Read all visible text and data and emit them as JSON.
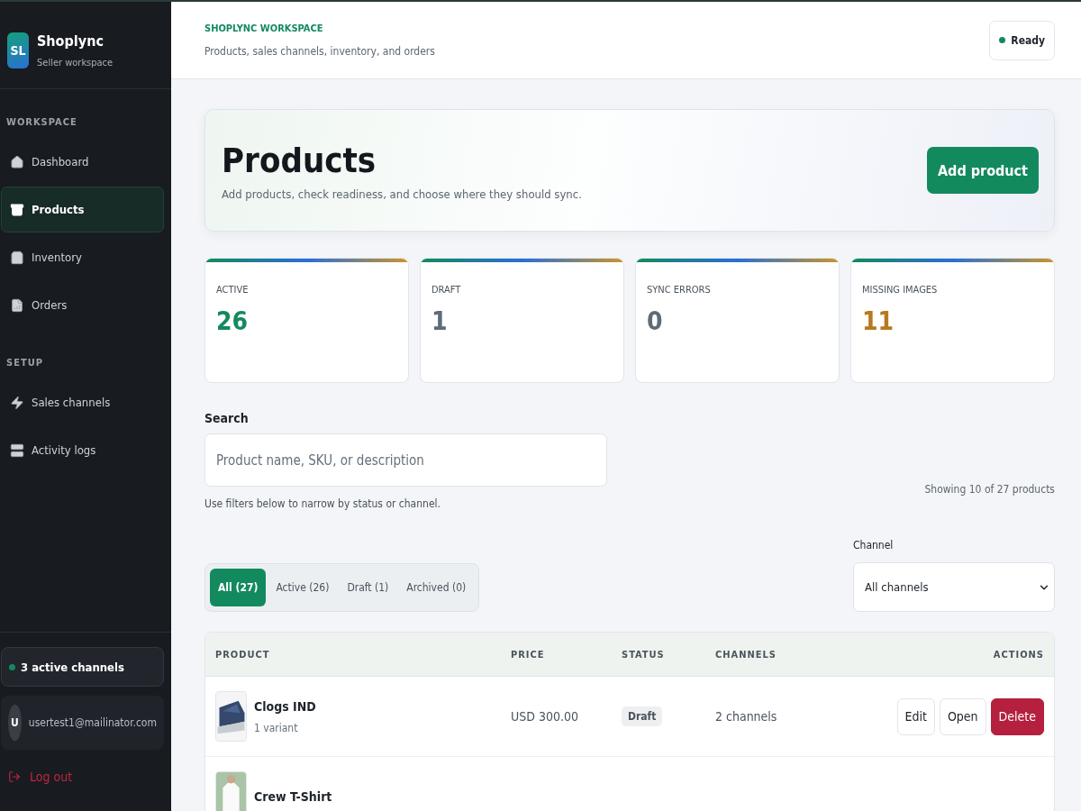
{
  "brand": {
    "initials": "SL",
    "name": "Shoplync",
    "subtitle": "Seller workspace"
  },
  "sidebar": {
    "sections": [
      {
        "heading": "WORKSPACE",
        "items": [
          {
            "label": "Dashboard",
            "selected": false
          },
          {
            "label": "Products",
            "selected": true
          },
          {
            "label": "Inventory",
            "selected": false
          },
          {
            "label": "Orders",
            "selected": false
          }
        ]
      },
      {
        "heading": "SETUP",
        "items": [
          {
            "label": "Sales channels",
            "selected": false
          },
          {
            "label": "Activity logs",
            "selected": false
          }
        ]
      }
    ],
    "channels_status": "3 active channels",
    "user": {
      "avatar": "U",
      "email": "usertest1@mailinator.com"
    },
    "logout": "Log out"
  },
  "header": {
    "eyebrow": "SHOPLYNC WORKSPACE",
    "subtitle": "Products, sales channels, inventory, and orders",
    "status": "Ready"
  },
  "hero": {
    "title": "Products",
    "description": "Add products, check readiness, and choose where they should sync.",
    "button": "Add product"
  },
  "stats": [
    {
      "label": "ACTIVE",
      "value": "26",
      "color": "#138a5e"
    },
    {
      "label": "DRAFT",
      "value": "1",
      "color": "#5f6b78"
    },
    {
      "label": "SYNC ERRORS",
      "value": "0",
      "color": "#5f6b78"
    },
    {
      "label": "MISSING IMAGES",
      "value": "11",
      "color": "#b7791f"
    }
  ],
  "search": {
    "label": "Search",
    "placeholder": "Product name, SKU, or description",
    "hint": "Use filters below to narrow by status or channel.",
    "count": "Showing 10 of 27 products"
  },
  "filters": {
    "tabs": [
      {
        "label": "All (27)",
        "selected": true
      },
      {
        "label": "Active (26)",
        "selected": false
      },
      {
        "label": "Draft (1)",
        "selected": false
      },
      {
        "label": "Archived (0)",
        "selected": false
      }
    ],
    "channel_label": "Channel",
    "channel_value": "All channels"
  },
  "table": {
    "columns": [
      "PRODUCT",
      "PRICE",
      "STATUS",
      "CHANNELS",
      "ACTIONS"
    ],
    "rows": [
      {
        "name": "Clogs IND",
        "variants": "1 variant",
        "price": "USD 300.00",
        "status": "Draft",
        "active": false,
        "channels": "2 channels",
        "actions": [
          "Edit",
          "Open",
          "Delete"
        ]
      },
      {
        "name": "Crew T-Shirt"
      }
    ]
  }
}
